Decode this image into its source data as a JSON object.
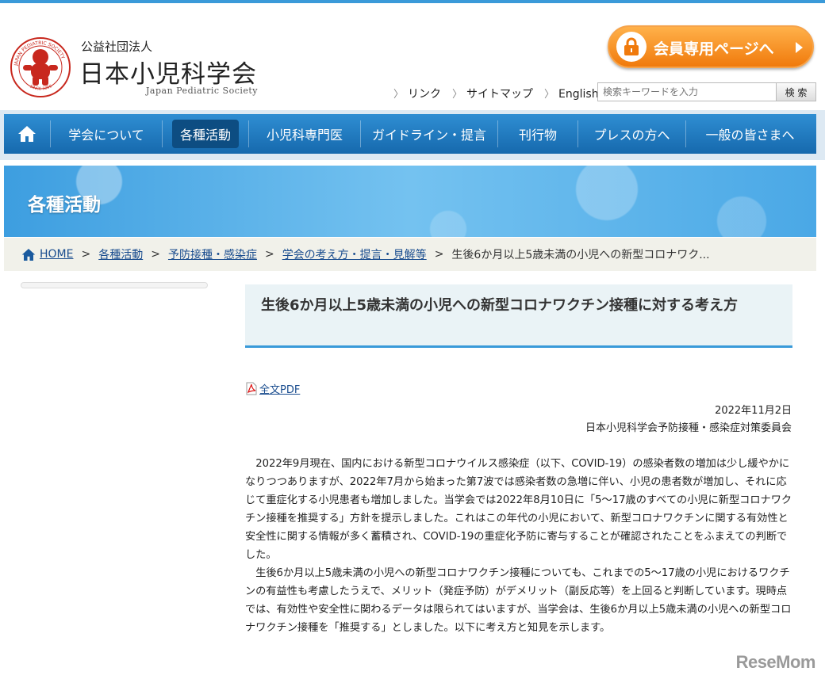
{
  "header": {
    "org_type": "公益社団法人",
    "org_name": "日本小児科学会",
    "org_name_en": "Japan Pediatric Society",
    "logo_ring_top": "JAPAN PEDIATRIC SOCIETY",
    "logo_ring_bottom": "SINCE 1896",
    "member_button": "会員専用ページへ",
    "util_links": [
      "リンク",
      "サイトマップ",
      "English"
    ],
    "search_placeholder": "検索キーワードを入力",
    "search_button": "検 索"
  },
  "nav": {
    "home_icon": "home-icon",
    "items": [
      "学会について",
      "各種活動",
      "小児科専門医",
      "ガイドライン・提言",
      "刊行物",
      "プレスの方へ",
      "一般の皆さまへ"
    ],
    "active": "各種活動"
  },
  "banner": {
    "title": "各種活動"
  },
  "breadcrumb": {
    "items": [
      "HOME",
      "各種活動",
      "予防接種・感染症",
      "学会の考え方・提言・見解等"
    ],
    "current": "生後6か月以上5歳未満の小児への新型コロナワク..."
  },
  "article": {
    "title": "生後6か月以上5歳未満の小児への新型コロナワクチン接種に対する考え方",
    "pdf_label": "全文PDF",
    "date": "2022年11月2日",
    "committee": "日本小児科学会予防接種・感染症対策委員会",
    "paragraphs": [
      "2022年9月現在、国内における新型コロナウイルス感染症（以下、COVID-19）の感染者数の増加は少し緩やかになりつつありますが、2022年7月から始まった第7波では感染者数の急増に伴い、小児の患者数が増加し、それに応じて重症化する小児患者も増加しました。当学会では2022年8月10日に「5～17歳のすべての小児に新型コロナワクチン接種を推奨する」方針を提示しました。これはこの年代の小児において、新型コロナワクチンに関する有効性と安全性に関する情報が多く蓄積され、COVID-19の重症化予防に寄与することが確認されたことをふまえての判断でした。",
      "生後6か月以上5歳未満の小児への新型コロナワクチン接種についても、これまでの5～17歳の小児におけるワクチンの有益性も考慮したうえで、メリット（発症予防）がデメリット（副反応等）を上回ると判断しています。現時点では、有効性や安全性に関わるデータは限られてはいますが、当学会は、生後6か月以上5歳未満の小児への新型コロナワクチン接種を「推奨する」としました。以下に考え方と知見を示します。"
    ]
  },
  "watermark": "ReseMom",
  "colors": {
    "accent": "#3a9ad9",
    "nav": "#1e7bc2",
    "member_button": "#f38a1c",
    "logo_red": "#c8281e"
  }
}
